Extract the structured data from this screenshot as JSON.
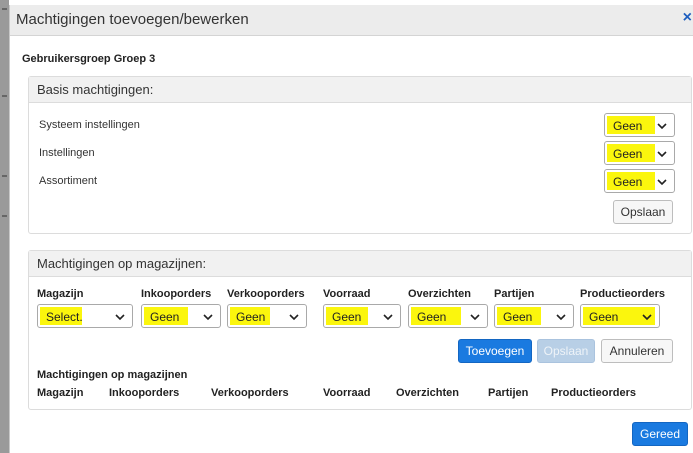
{
  "dialog": {
    "title": "Machtigingen toevoegen/bewerken",
    "close": "×",
    "group_title": "Gebruikersgroep Groep 3"
  },
  "basis": {
    "title": "Basis machtigingen:",
    "rows": [
      {
        "label": "Systeem instellingen",
        "value": "Geen"
      },
      {
        "label": "Instellingen",
        "value": "Geen"
      },
      {
        "label": "Assortiment",
        "value": "Geen"
      }
    ],
    "save_label": "Opslaan"
  },
  "magazijnen": {
    "title": "Machtigingen op magazijnen:",
    "columns": [
      "Magazijn",
      "Inkooporders",
      "Verkooporders",
      "Voorraad",
      "Overzichten",
      "Partijen",
      "Productieorders"
    ],
    "selects": [
      "Select.",
      "Geen",
      "Geen",
      "Geen",
      "Geen",
      "Geen",
      "Geen"
    ],
    "add_label": "Toevoegen",
    "save_label": "Opslaan",
    "cancel_label": "Annuleren",
    "list_title": "Machtigingen op magazijnen",
    "list_columns": [
      "Magazijn",
      "Inkooporders",
      "Verkooporders",
      "Voorraad",
      "Overzichten",
      "Partijen",
      "Productieorders"
    ]
  },
  "footer": {
    "done_label": "Gereed"
  },
  "colors": {
    "highlight": "#fbf500",
    "primary": "#1a7ae0",
    "header_bg": "#ececec"
  }
}
